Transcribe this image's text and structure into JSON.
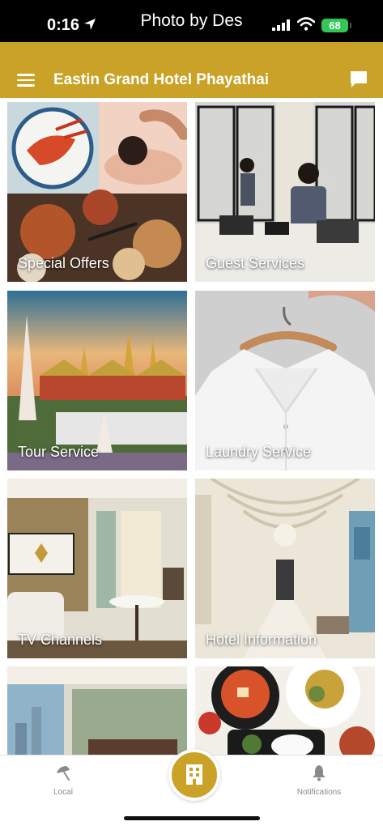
{
  "status_bar": {
    "time": "0:16",
    "center_text": "Photo by Des",
    "battery": "68"
  },
  "header": {
    "title": "Eastin Grand Hotel Phayathai"
  },
  "tiles": [
    {
      "label": "Special Offers"
    },
    {
      "label": "Guest Services"
    },
    {
      "label": "Tour Service"
    },
    {
      "label": "Laundry Service"
    },
    {
      "label": "TV Channels"
    },
    {
      "label": "Hotel Information"
    },
    {
      "label": ""
    },
    {
      "label": ""
    }
  ],
  "tab_bar": {
    "local_label": "Local",
    "notifications_label": "Notifications"
  },
  "colors": {
    "accent": "#c9a227",
    "status_bar": "#000000",
    "battery": "#33c759"
  },
  "icons": [
    "location-arrow-icon",
    "signal-icon",
    "wifi-icon",
    "battery-icon",
    "menu-icon",
    "chat-icon",
    "umbrella-icon",
    "building-icon",
    "bell-icon"
  ]
}
